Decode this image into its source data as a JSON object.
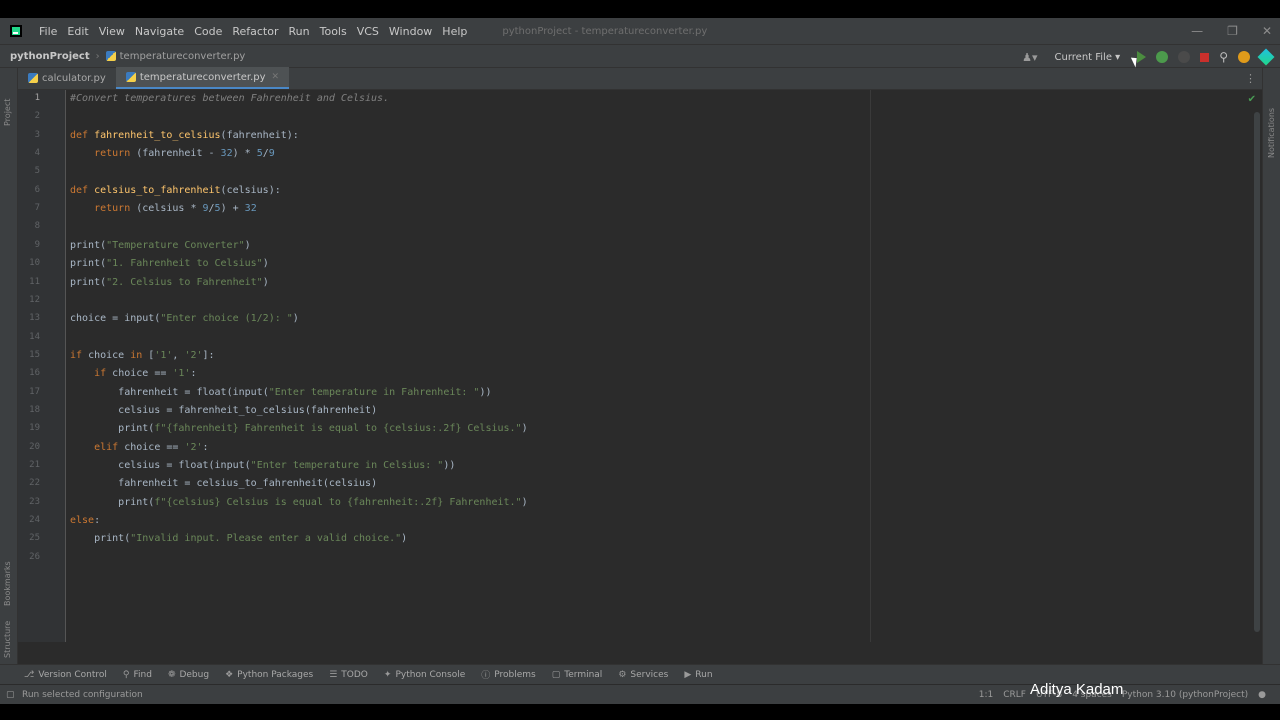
{
  "menubar": {
    "items": [
      "File",
      "Edit",
      "View",
      "Navigate",
      "Code",
      "Refactor",
      "Run",
      "Tools",
      "VCS",
      "Window",
      "Help"
    ],
    "window_title": "pythonProject - temperatureconverter.py"
  },
  "navbar": {
    "project": "pythonProject",
    "file": "temperatureconverter.py",
    "run_config": "Current File"
  },
  "tabs": [
    {
      "label": "calculator.py",
      "active": false
    },
    {
      "label": "temperatureconverter.py",
      "active": true
    }
  ],
  "left_strip": {
    "project": "Project",
    "bookmarks": "Bookmarks",
    "structure": "Structure"
  },
  "right_strip": {
    "notifications": "Notifications"
  },
  "editor": {
    "current_line": 1,
    "lines": [
      "#Convert temperatures between Fahrenheit and Celsius.",
      "",
      "def fahrenheit_to_celsius(fahrenheit):",
      "    return (fahrenheit - 32) * 5/9",
      "",
      "def celsius_to_fahrenheit(celsius):",
      "    return (celsius * 9/5) + 32",
      "",
      "print(\"Temperature Converter\")",
      "print(\"1. Fahrenheit to Celsius\")",
      "print(\"2. Celsius to Fahrenheit\")",
      "",
      "choice = input(\"Enter choice (1/2): \")",
      "",
      "if choice in ['1', '2']:",
      "    if choice == '1':",
      "        fahrenheit = float(input(\"Enter temperature in Fahrenheit: \"))",
      "        celsius = fahrenheit_to_celsius(fahrenheit)",
      "        print(f\"{fahrenheit} Fahrenheit is equal to {celsius:.2f} Celsius.\")",
      "    elif choice == '2':",
      "        celsius = float(input(\"Enter temperature in Celsius: \"))",
      "        fahrenheit = celsius_to_fahrenheit(celsius)",
      "        print(f\"{celsius} Celsius is equal to {fahrenheit:.2f} Fahrenheit.\")",
      "else:",
      "    print(\"Invalid input. Please enter a valid choice.\")",
      ""
    ]
  },
  "tool_windows": [
    "Version Control",
    "Find",
    "Debug",
    "Python Packages",
    "TODO",
    "Python Console",
    "Problems",
    "Terminal",
    "Services",
    "Run"
  ],
  "status": {
    "message": "Run selected configuration",
    "position": "1:1",
    "line_sep": "CRLF",
    "encoding": "UTF-8",
    "indent": "4 spaces",
    "interpreter": "Python 3.10 (pythonProject)"
  },
  "watermark": "Aditya Kadam"
}
